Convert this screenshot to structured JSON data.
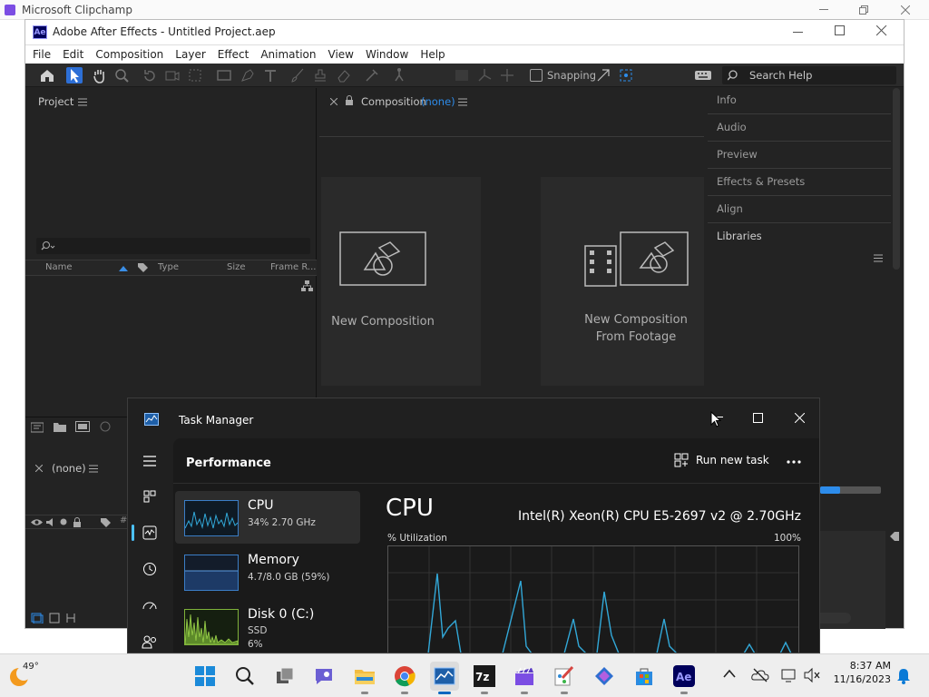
{
  "clipchamp": {
    "title": "Microsoft Clipchamp"
  },
  "ae": {
    "title": "Adobe After Effects - Untitled Project.aep",
    "logo": "Ae",
    "menu": [
      "File",
      "Edit",
      "Composition",
      "Layer",
      "Effect",
      "Animation",
      "View",
      "Window",
      "Help"
    ],
    "toolbar": {
      "snapping_label": "Snapping",
      "search_placeholder": "Search Help"
    },
    "project": {
      "label": "Project",
      "columns": [
        "Name",
        "Type",
        "Size",
        "Frame R..."
      ]
    },
    "composition": {
      "label": "Composition",
      "value": "(none)",
      "new_comp": "New Composition",
      "new_from_footage_line1": "New Composition",
      "new_from_footage_line2": "From Footage"
    },
    "right_panels": [
      "Info",
      "Audio",
      "Preview",
      "Effects & Presets",
      "Align",
      "Libraries"
    ],
    "timeline": {
      "tab_label": "(none)"
    }
  },
  "task_manager": {
    "title": "Task Manager",
    "section": "Performance",
    "run_new_task": "Run new task",
    "resources": [
      {
        "name": "CPU",
        "sub1": "34% 2.70 GHz",
        "sub2": ""
      },
      {
        "name": "Memory",
        "sub1": "4.7/8.0 GB (59%)",
        "sub2": ""
      },
      {
        "name": "Disk 0 (C:)",
        "sub1": "SSD",
        "sub2": "6%"
      }
    ],
    "cpu": {
      "heading": "CPU",
      "model": "Intel(R) Xeon(R) CPU E5-2697 v2 @ 2.70GHz",
      "util_label": "% Utilization",
      "util_max": "100%"
    }
  },
  "taskbar": {
    "weather_temp": "49°",
    "time": "8:37 AM",
    "date": "11/16/2023",
    "apps": [
      "start-icon",
      "search-icon",
      "task-view-icon",
      "teams-chat-icon",
      "file-explorer-icon",
      "chrome-icon",
      "task-manager-icon",
      "7zip-icon",
      "clipchamp-icon",
      "paint-icon",
      "copilot-icon",
      "store-icon",
      "after-effects-icon"
    ]
  },
  "colors": {
    "ae_bg": "#232323",
    "accent_blue": "#2d8ceb",
    "tm_bg": "#202020",
    "graph_line": "#32a8d8"
  }
}
